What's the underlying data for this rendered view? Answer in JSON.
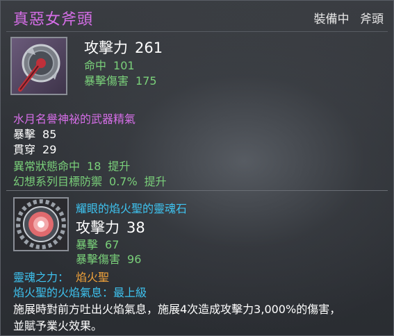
{
  "title": "真惡女斧頭",
  "status": {
    "equipped": "裝備中",
    "type": "斧頭"
  },
  "weapon": {
    "attack_label": "攻擊力",
    "attack_value": "261",
    "stats": [
      {
        "label": "命中",
        "value": "101"
      },
      {
        "label": "暴擊傷害",
        "value": "175"
      }
    ]
  },
  "essence": {
    "name": "水月名譽神祕的武器精氣",
    "stats": [
      {
        "label": "暴擊",
        "value": "85"
      },
      {
        "label": "貫穿",
        "value": "29"
      }
    ],
    "bonuses": [
      {
        "label": "異常狀態命中",
        "value": "18",
        "suffix": "提升"
      },
      {
        "label": "幻想系列目標防禦",
        "value": "0.7%",
        "suffix": "提升"
      }
    ]
  },
  "soul_stone": {
    "name": "耀眼的焰火聖的靈魂石",
    "attack_label": "攻擊力",
    "attack_value": "38",
    "stats": [
      {
        "label": "暴擊",
        "value": "67"
      },
      {
        "label": "暴擊傷害",
        "value": "96"
      }
    ],
    "soul_power_label": "靈魂之力：",
    "soul_power_value": "焰火聖",
    "flame_label": "焰火聖的火焰氣息：最上級",
    "description_1": "施展時對前方吐出火焰氣息，施展4次造成攻擊力3,000%的傷害，",
    "description_2": "並賦予業火效果。"
  },
  "colors": {
    "title": "#d66ee8",
    "stat_green": "#7ad07a",
    "cyan": "#3ec3f0",
    "orange": "#f0a23a"
  }
}
